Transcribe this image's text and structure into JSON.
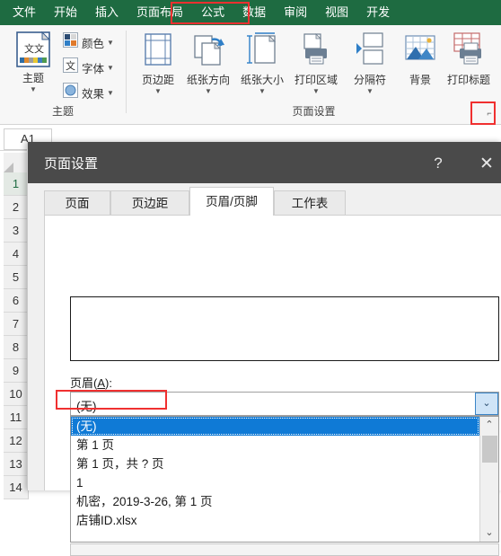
{
  "ribbon": {
    "tabs": [
      {
        "label": "文件"
      },
      {
        "label": "开始"
      },
      {
        "label": "插入"
      },
      {
        "label": "页面布局"
      },
      {
        "label": "公式"
      },
      {
        "label": "数据"
      },
      {
        "label": "审阅"
      },
      {
        "label": "视图"
      },
      {
        "label": "开发"
      }
    ],
    "active_tab": "页面布局",
    "highlight_color": "#f03030",
    "bar_color": "#1e6b41",
    "groups": [
      {
        "label": "主题"
      },
      {
        "label": "页面设置"
      }
    ],
    "theme_group": {
      "big_button": {
        "label": "主题",
        "caret": "▼"
      },
      "small_buttons": [
        {
          "label": "颜色",
          "caret": "▼",
          "icon": "theme-colors-icon"
        },
        {
          "label": "字体",
          "caret": "▼",
          "icon": "theme-fonts-icon"
        },
        {
          "label": "效果",
          "caret": "▼",
          "icon": "theme-effects-icon"
        }
      ]
    },
    "page_setup_group": {
      "buttons": [
        {
          "label": "页边距",
          "caret": "▼",
          "icon": "margins-icon"
        },
        {
          "label": "纸张方向",
          "caret": "▼",
          "icon": "orientation-icon"
        },
        {
          "label": "纸张大小",
          "caret": "▼",
          "icon": "paper-size-icon"
        },
        {
          "label": "打印区域",
          "caret": "▼",
          "icon": "print-area-icon"
        },
        {
          "label": "分隔符",
          "caret": "▼",
          "icon": "breaks-icon"
        },
        {
          "label": "背景",
          "caret": "",
          "icon": "background-icon"
        },
        {
          "label": "打印标题",
          "caret": "",
          "icon": "print-titles-icon"
        }
      ],
      "dialog_launcher": "⌐"
    }
  },
  "sheet": {
    "name_box_value": "A1",
    "row_headers": [
      "1",
      "2",
      "3",
      "4",
      "5",
      "6",
      "7",
      "8",
      "9",
      "10",
      "11",
      "12",
      "13",
      "14"
    ],
    "selected_row": "1"
  },
  "dialog": {
    "title": "页面设置",
    "help_glyph": "?",
    "close_glyph": "✕",
    "tabs": [
      {
        "label": "页面",
        "active": false
      },
      {
        "label": "页边距",
        "active": false
      },
      {
        "label": "页眉/页脚",
        "active": true
      },
      {
        "label": "工作表",
        "active": false
      }
    ],
    "header_label_prefix": "页眉(",
    "header_label_key": "A",
    "header_label_suffix": "):",
    "combo": {
      "value": "(无)",
      "arrow_glyph": "⌄"
    },
    "dropdown": {
      "items": [
        {
          "text": "(无)",
          "selected": true
        },
        {
          "text": "第 1 页",
          "selected": false
        },
        {
          "text": "第 1 页，共 ? 页",
          "selected": false,
          "highlighted": true
        },
        {
          "text": "1",
          "selected": false
        },
        {
          "text": "机密，2019-3-26, 第 1 页",
          "selected": false
        },
        {
          "text": "店铺ID.xlsx",
          "selected": false
        }
      ],
      "scroll_up_glyph": "⌃",
      "scroll_down_glyph": "⌄"
    }
  }
}
